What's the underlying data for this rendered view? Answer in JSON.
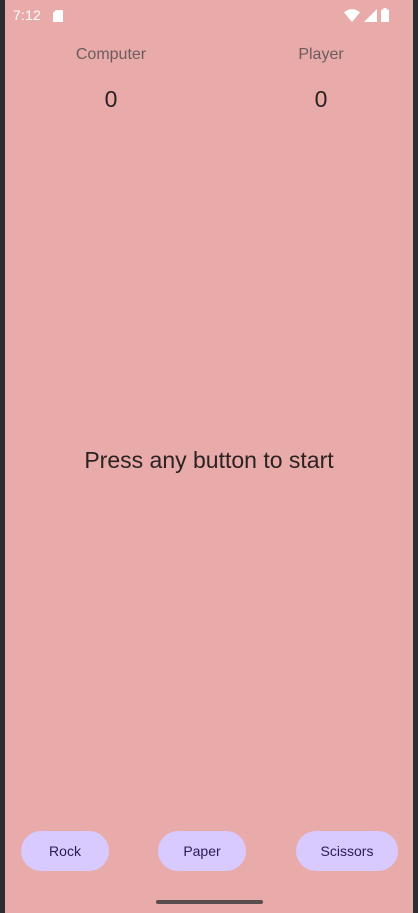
{
  "status_bar": {
    "time": "7:12",
    "icons": [
      "sd-card-icon",
      "wifi-icon",
      "signal-icon",
      "battery-icon"
    ]
  },
  "scoreboard": {
    "computer": {
      "label": "Computer",
      "score": "0"
    },
    "player": {
      "label": "Player",
      "score": "0"
    }
  },
  "message": "Press any button to start",
  "buttons": {
    "rock": "Rock",
    "paper": "Paper",
    "scissors": "Scissors"
  },
  "colors": {
    "background": "#e9aaaa",
    "button": "#d8c9ff",
    "button_text": "#2a1a55",
    "frame": "#2d2c30"
  }
}
